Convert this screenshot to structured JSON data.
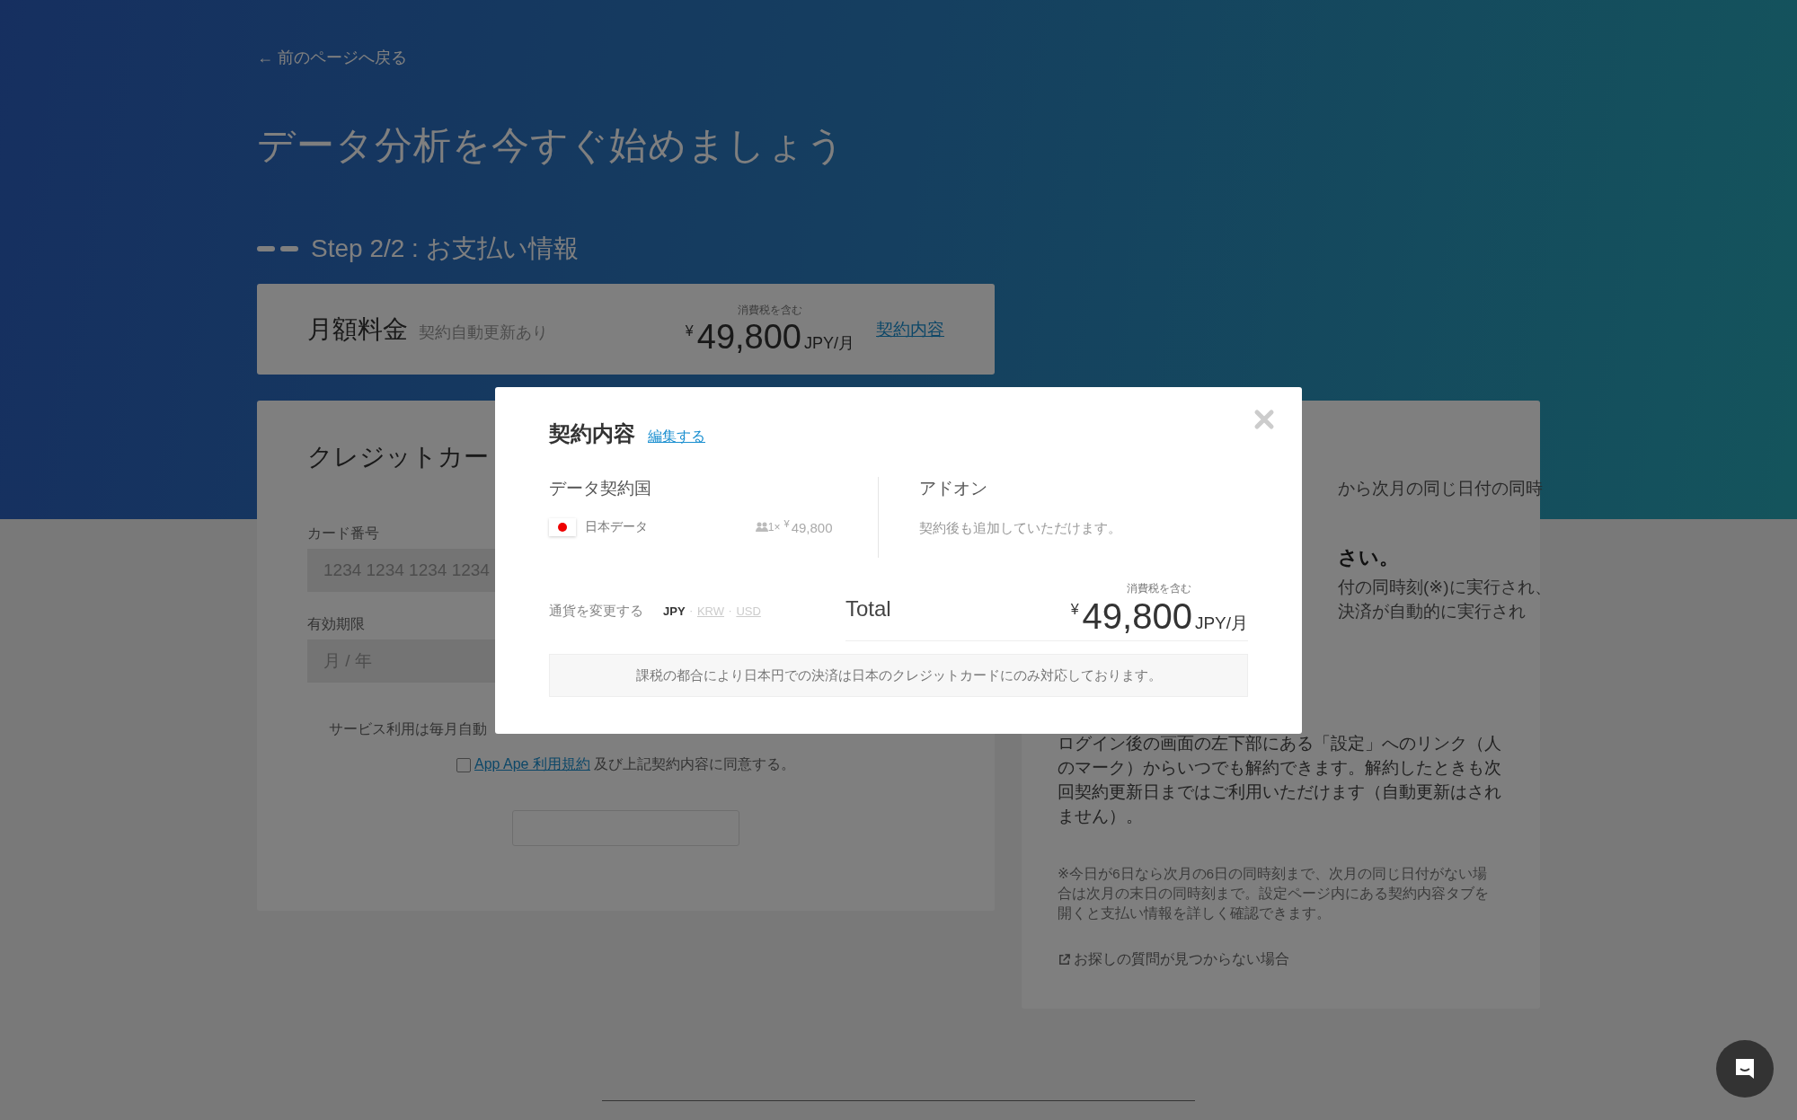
{
  "back_link": "← 前のページへ戻る",
  "title": "データ分析を今すぐ始めましょう",
  "step": {
    "label": "Step 2/2 : お支払い情報"
  },
  "price_card": {
    "title": "月額料金",
    "subtitle": "契約自動更新あり",
    "tax_note": "消費税を含む",
    "currency_symbol": "¥",
    "amount": "49,800",
    "unit": "JPY/月",
    "link": "契約内容"
  },
  "card_form": {
    "title": "クレジットカー",
    "fields": [
      {
        "label": "カード番号",
        "placeholder": "1234 1234 1234 1234"
      },
      {
        "label": "有効期限",
        "placeholder": "月 / 年"
      }
    ],
    "notice": "サービス利用は毎月自動",
    "agree": {
      "checked": false,
      "link": "App Ape 利用規約",
      "text": "及び上記契約内容に同意する。"
    }
  },
  "info_card": {
    "fragments": [
      {
        "kind": "plain",
        "text": "から次月の同じ日付の同時"
      },
      {
        "kind": "bold",
        "text": "さい。"
      },
      {
        "kind": "plain",
        "text": "付の同時刻(※)に実行され、"
      },
      {
        "kind": "plain",
        "text": "決済が自動的に実行され"
      }
    ],
    "cancel_text": "ログイン後の画面の左下部にある「設定」へのリンク（人のマーク）からいつでも解約できます。解約したときも次回契約更新日まではご利用いただけます（自動更新はされません）。",
    "footnote": "※今日が6日なら次月の6日の同時刻まで、次月の同じ日付がない場合は次月の末日の同時刻まで。設定ページ内にある契約内容タブを開くと支払い情報を詳しく確認できます。",
    "help_link": "お探しの質問が見つからない場合"
  },
  "modal": {
    "title": "契約内容",
    "edit_link": "編集する",
    "countries": {
      "heading": "データ契約国",
      "items": [
        {
          "name": "日本データ",
          "quantity": "1×",
          "currency_symbol": "¥",
          "price": "49,800"
        }
      ]
    },
    "addons": {
      "heading": "アドオン",
      "note": "契約後も追加していただけます。"
    },
    "currency": {
      "label": "通貨を変更する",
      "separator": "·",
      "options": [
        {
          "label": "JPY",
          "selected": true
        },
        {
          "label": "KRW",
          "selected": false
        },
        {
          "label": "USD",
          "selected": false
        }
      ]
    },
    "total": {
      "label": "Total",
      "tax_note": "消費税を含む",
      "currency_symbol": "¥",
      "amount": "49,800",
      "unit": "JPY/月"
    },
    "notice": "課税の都合により日本円での決済は日本のクレジットカードにのみ対応しております。"
  }
}
